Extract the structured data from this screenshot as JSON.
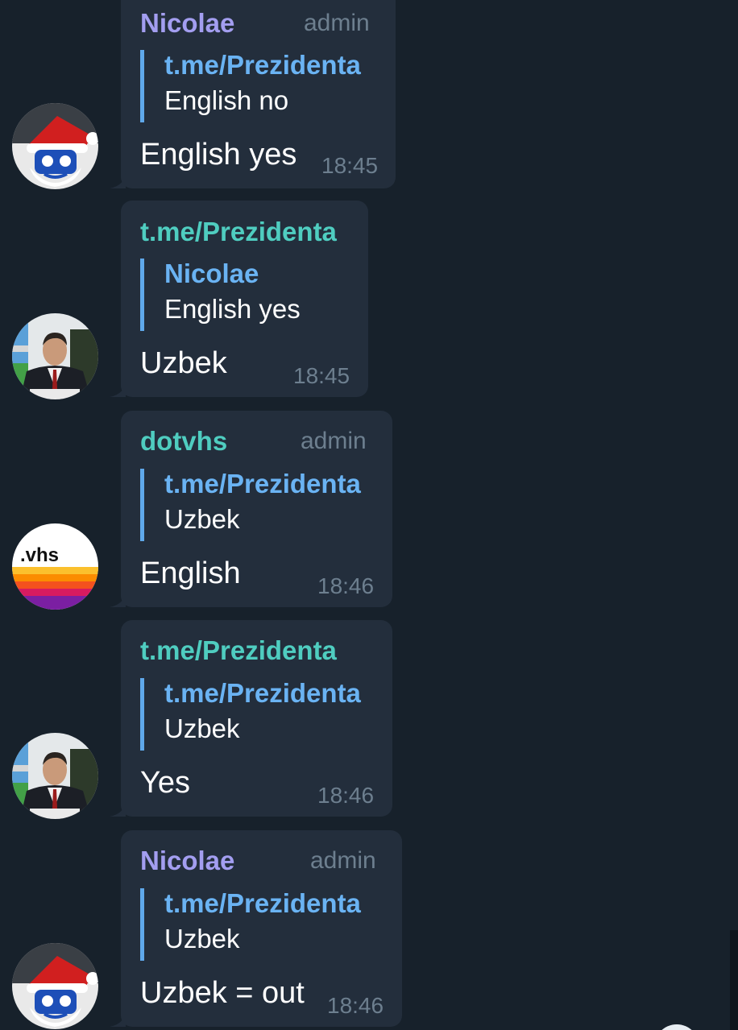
{
  "messages": [
    {
      "sender": "Nicolae",
      "badge": "admin",
      "reply_to": {
        "name": "t.me/Prezidenta",
        "text": "English no"
      },
      "text": "English yes",
      "time": "18:45",
      "avatar_icon": "santa-avatar-icon"
    },
    {
      "sender": "t.me/Prezidenta",
      "badge": "",
      "reply_to": {
        "name": "Nicolae",
        "text": "English yes"
      },
      "text": "Uzbek",
      "time": "18:45",
      "avatar_icon": "president-avatar-icon"
    },
    {
      "sender": "dotvhs",
      "badge": "admin",
      "reply_to": {
        "name": "t.me/Prezidenta",
        "text": "Uzbek"
      },
      "text": "English",
      "time": "18:46",
      "avatar_icon": "vhs-avatar-icon",
      "avatar_label": ".vhs"
    },
    {
      "sender": "t.me/Prezidenta",
      "badge": "",
      "reply_to": {
        "name": "t.me/Prezidenta",
        "text": "Uzbek"
      },
      "text": "Yes",
      "time": "18:46",
      "avatar_icon": "president-avatar-icon"
    },
    {
      "sender": "Nicolae",
      "badge": "admin",
      "reply_to": {
        "name": "t.me/Prezidenta",
        "text": "Uzbek"
      },
      "text": "Uzbek = out",
      "time": "18:46",
      "avatar_icon": "santa-avatar-icon"
    }
  ],
  "colors": {
    "background": "#17212b",
    "bubble": "#232e3c",
    "sender_nicolae": "#a39ef0",
    "sender_teal": "#4fcdc0",
    "reply_accent": "#6ab3f3",
    "meta_text": "#6d7f8f"
  }
}
